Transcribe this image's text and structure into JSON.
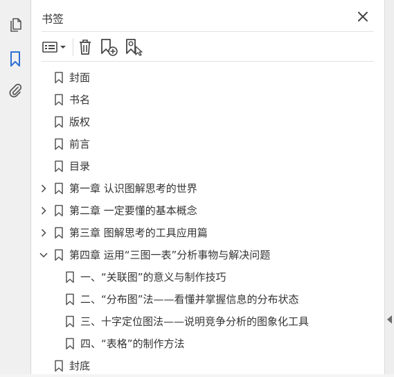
{
  "panel": {
    "title": "书签"
  },
  "rail": {
    "icons": [
      "pages-icon",
      "bookmarks-icon",
      "attachments-icon"
    ],
    "active": "bookmarks-icon",
    "accent": "#2d6fd2"
  },
  "toolbar": {
    "icons": [
      "options-menu-icon",
      "delete-icon",
      "new-bookmark-icon",
      "bookmark-from-selection-icon"
    ]
  },
  "bookmarks": [
    {
      "label": "封面",
      "level": 0,
      "expander": "none"
    },
    {
      "label": "书名",
      "level": 0,
      "expander": "none"
    },
    {
      "label": "版权",
      "level": 0,
      "expander": "none"
    },
    {
      "label": "前言",
      "level": 0,
      "expander": "none"
    },
    {
      "label": "目录",
      "level": 0,
      "expander": "none"
    },
    {
      "label": "第一章  认识图解思考的世界",
      "level": 0,
      "expander": "collapsed"
    },
    {
      "label": "第二章  一定要懂的基本概念",
      "level": 0,
      "expander": "collapsed"
    },
    {
      "label": "第三章  图解思考的工具应用篇",
      "level": 0,
      "expander": "collapsed"
    },
    {
      "label": "第四章  运用“三图一表”分析事物与解决问题",
      "level": 0,
      "expander": "expanded"
    },
    {
      "label": "一、“关联图”的意义与制作技巧",
      "level": 1,
      "expander": "none"
    },
    {
      "label": "二、“分布图”法——看懂并掌握信息的分布状态",
      "level": 1,
      "expander": "none"
    },
    {
      "label": "三、十字定位图法——说明竞争分析的图象化工具",
      "level": 1,
      "expander": "none"
    },
    {
      "label": "四、“表格”的制作方法",
      "level": 1,
      "expander": "none"
    },
    {
      "label": "封底",
      "level": 0,
      "expander": "none"
    }
  ]
}
